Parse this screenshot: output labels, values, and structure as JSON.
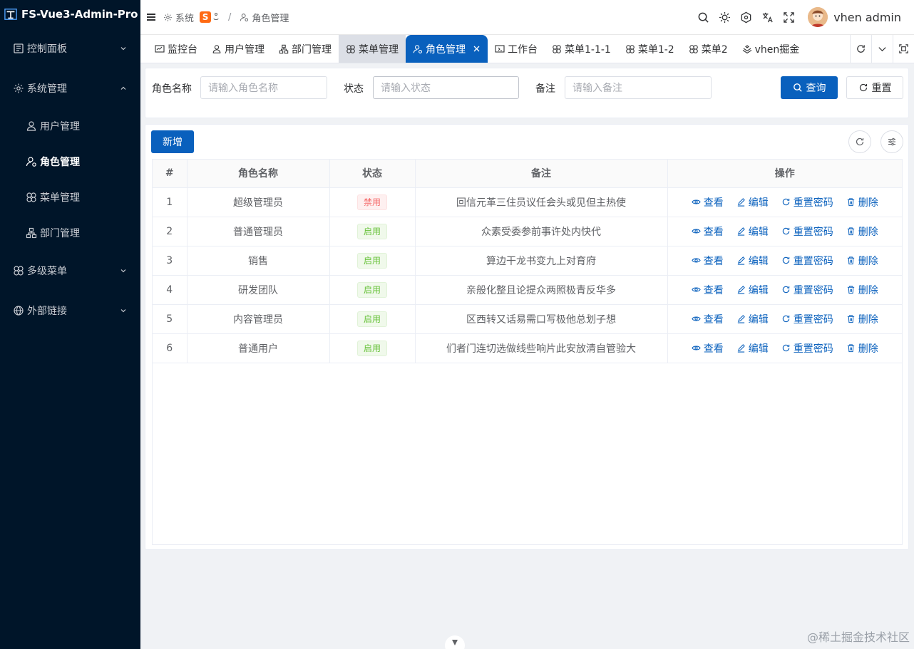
{
  "app": {
    "title": "FS-Vue3-Admin-Pro"
  },
  "sidebar": {
    "items": [
      {
        "label": "控制面板",
        "icon": "dashboard-icon",
        "expanded": false
      },
      {
        "label": "系统管理",
        "icon": "gear-icon",
        "expanded": true,
        "children": [
          {
            "label": "用户管理",
            "icon": "user-icon",
            "active": false
          },
          {
            "label": "角色管理",
            "icon": "user-role-icon",
            "active": true
          },
          {
            "label": "菜单管理",
            "icon": "menu-flower-icon",
            "active": false
          },
          {
            "label": "部门管理",
            "icon": "department-icon",
            "active": false
          }
        ]
      },
      {
        "label": "多级菜单",
        "icon": "menu-flower-icon",
        "expanded": false
      },
      {
        "label": "外部链接",
        "icon": "globe-icon",
        "expanded": false
      }
    ]
  },
  "header": {
    "breadcrumb": {
      "parent": "系统",
      "current": "角色管理"
    },
    "ime_label": "S",
    "user_name": "vhen admin"
  },
  "tabs": [
    {
      "label": "监控台",
      "icon": "monitor-icon"
    },
    {
      "label": "用户管理",
      "icon": "user-icon"
    },
    {
      "label": "部门管理",
      "icon": "department-icon"
    },
    {
      "label": "菜单管理",
      "icon": "menu-flower-icon"
    },
    {
      "label": "角色管理",
      "icon": "user-role-icon",
      "active": true
    },
    {
      "label": "工作台",
      "icon": "workbench-icon"
    },
    {
      "label": "菜单1-1-1",
      "icon": "menu-flower-icon"
    },
    {
      "label": "菜单1-2",
      "icon": "menu-flower-icon"
    },
    {
      "label": "菜单2",
      "icon": "menu-flower-icon"
    },
    {
      "label": "vhen掘金",
      "icon": "juejin-icon"
    }
  ],
  "search": {
    "role_name_label": "角色名称",
    "role_name_placeholder": "请输入角色名称",
    "status_label": "状态",
    "status_placeholder": "请输入状态",
    "remark_label": "备注",
    "remark_placeholder": "请输入备注",
    "query_label": "查询",
    "reset_label": "重置"
  },
  "toolbar": {
    "add_label": "新增"
  },
  "table": {
    "columns": [
      "#",
      "角色名称",
      "状态",
      "备注",
      "操作"
    ],
    "actions": {
      "view": "查看",
      "edit": "编辑",
      "reset_pwd": "重置密码",
      "delete": "删除"
    },
    "rows": [
      {
        "index": "1",
        "name": "超级管理员",
        "status": "禁用",
        "status_type": "disabled",
        "remark": "回信元革三住员议任会头或见但主热使"
      },
      {
        "index": "2",
        "name": "普通管理员",
        "status": "启用",
        "status_type": "enabled",
        "remark": "众素受委参前事许处内快代"
      },
      {
        "index": "3",
        "name": "销售",
        "status": "启用",
        "status_type": "enabled",
        "remark": "算边干龙书变九上对育府"
      },
      {
        "index": "4",
        "name": "研发团队",
        "status": "启用",
        "status_type": "enabled",
        "remark": "亲般化整且论提众两照极青反华多"
      },
      {
        "index": "5",
        "name": "内容管理员",
        "status": "启用",
        "status_type": "enabled",
        "remark": "区西转又话易需口写极他总划子想"
      },
      {
        "index": "6",
        "name": "普通用户",
        "status": "启用",
        "status_type": "enabled",
        "remark": "们者门连切选做线些响片此安放清自管验大"
      }
    ]
  },
  "watermark": "@稀土掘金技术社区",
  "colors": {
    "primary": "#0960bd",
    "sidebar_bg": "#001529",
    "danger": "#f56c6c",
    "success": "#67c23a"
  }
}
